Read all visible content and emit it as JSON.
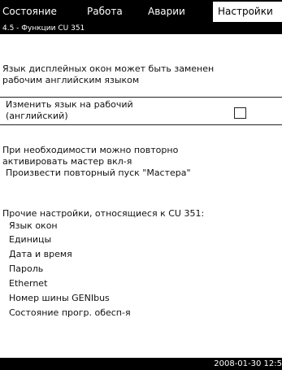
{
  "tabs": [
    {
      "label": "Состояние"
    },
    {
      "label": "Работа"
    },
    {
      "label": "Аварии"
    },
    {
      "label": "Настройки"
    }
  ],
  "subheader": "4.5 - Функции CU 351",
  "language_note": {
    "line1": "Язык дисплейных окон может быть заменен",
    "line2": "рабочим английским языком"
  },
  "english_option": {
    "line1": "Изменить язык на рабочий",
    "line2": "(английский)"
  },
  "wizard_note": {
    "line1": "При необходимости можно повторно",
    "line2": "активировать мастер вкл-я",
    "line3": "Произвести повторный пуск \"Мастера\""
  },
  "other_settings": {
    "title": "Прочие настройки, относящиеся к CU 351:",
    "items": [
      {
        "label": "Язык окон"
      },
      {
        "label": "Единицы"
      },
      {
        "label": "Дата и время"
      },
      {
        "label": "Пароль"
      },
      {
        "label": "Ethernet"
      },
      {
        "label": "Номер шины GENIbus"
      },
      {
        "label": "Состояние прогр. обесп-я"
      }
    ]
  },
  "status": {
    "datetime": "2008-01-30 12:5"
  },
  "colors": {
    "bar": "#000000",
    "background": "#ffffff",
    "text": "#111111"
  }
}
